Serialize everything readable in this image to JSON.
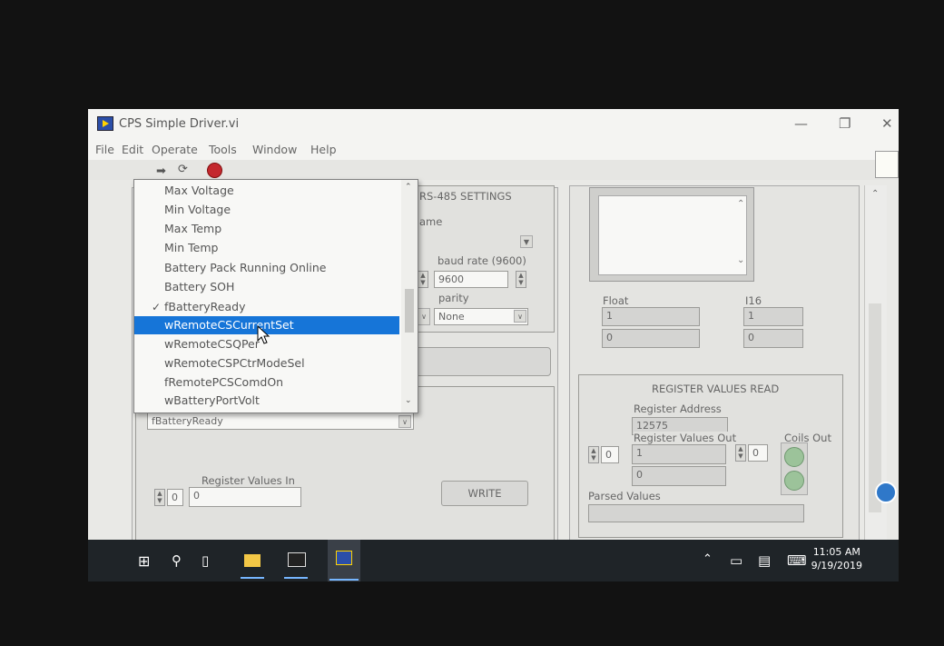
{
  "window": {
    "title": "CPS Simple Driver.vi",
    "minimize": "—",
    "restore": "❐",
    "close": "✕"
  },
  "menu": [
    "File",
    "Edit",
    "Operate",
    "Tools",
    "Window",
    "Help"
  ],
  "dropdown_list": {
    "items": [
      "Max Voltage",
      "Min Voltage",
      "Max Temp",
      "Min Temp",
      "Battery Pack Running Online",
      "Battery SOH",
      "fBatteryReady",
      "wRemoteCSCurrentSet",
      "wRemoteCSQPer",
      "wRemoteCSPCtrModeSel",
      "fRemotePCSComdOn",
      "wBatteryPortVolt"
    ],
    "checked_item": "fBatteryReady",
    "highlighted_item": "wRemoteCSCurrentSet"
  },
  "rs485": {
    "title": "RS-485 SETTINGS",
    "name_label": "ame",
    "baud_label": "baud rate (9600)",
    "baud_value": "9600",
    "parity_label": "parity",
    "parity_value": "None"
  },
  "write_panel": {
    "selected_register": "fBatteryReady",
    "register_values_in_label": "Register Values In",
    "index_value": "0",
    "value_in": "0",
    "write_button": "WRITE"
  },
  "display": {
    "float_label": "Float",
    "float_value_1": "1",
    "float_value_2": "0",
    "i16_label": "I16",
    "i16_value_1": "1",
    "i16_value_2": "0"
  },
  "register_read": {
    "title": "REGISTER VALUES READ",
    "address_label": "Register Address",
    "address_value": "12575",
    "values_out_label": "Register Values Out",
    "coils_out_label": "Coils Out",
    "index_value": "0",
    "value_1": "1",
    "value_2": "0",
    "coils_index": "0",
    "parsed_values_label": "Parsed Values",
    "parsed_values": ""
  },
  "taskbar": {
    "time": "11:05 AM",
    "date": "9/19/2019"
  }
}
